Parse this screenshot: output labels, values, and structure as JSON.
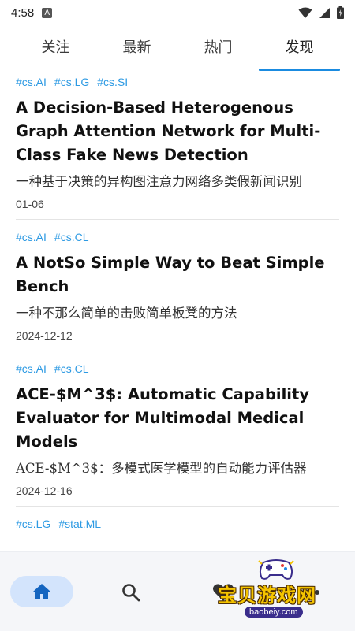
{
  "status_bar": {
    "time": "4:58",
    "notification_letter": "A"
  },
  "tabs": [
    {
      "label": "关注",
      "active": false
    },
    {
      "label": "最新",
      "active": false
    },
    {
      "label": "热门",
      "active": false
    },
    {
      "label": "发现",
      "active": true
    }
  ],
  "feed": [
    {
      "tags": [
        "#cs.AI",
        "#cs.LG",
        "#cs.SI"
      ],
      "title": "A Decision-Based Heterogenous Graph Attention Network for Multi-Class Fake News Detection",
      "subtitle": "一种基于决策的异构图注意力网络多类假新闻识别",
      "date": "01-06"
    },
    {
      "tags": [
        "#cs.AI",
        "#cs.CL"
      ],
      "title": "A NotSo Simple Way to Beat Simple Bench",
      "subtitle": "一种不那么简单的击败简单板凳的方法",
      "date": "2024-12-12"
    },
    {
      "tags": [
        "#cs.AI",
        "#cs.CL"
      ],
      "title": "ACE-$M^3$: Automatic Capability Evaluator for Multimodal Medical Models",
      "subtitle": "ACE-$M^3$：多模式医学模型的自动能力评估器",
      "date": "2024-12-16"
    },
    {
      "tags": [
        "#cs.LG",
        "#stat.ML"
      ],
      "title": "",
      "subtitle": "",
      "date": ""
    }
  ],
  "bottom_nav": {
    "items": [
      {
        "icon": "home-icon",
        "active": true
      },
      {
        "icon": "search-icon",
        "active": false
      },
      {
        "icon": "heart-icon",
        "active": false
      },
      {
        "icon": "more-icon",
        "active": false
      }
    ]
  },
  "watermark": {
    "text": "宝贝游戏网",
    "url": "baobeiy.com"
  },
  "colors": {
    "accent": "#1a8be0",
    "tag": "#2d9ae3",
    "nav_active_bg": "#d3e4fc",
    "nav_bg": "#f5f6f9"
  }
}
